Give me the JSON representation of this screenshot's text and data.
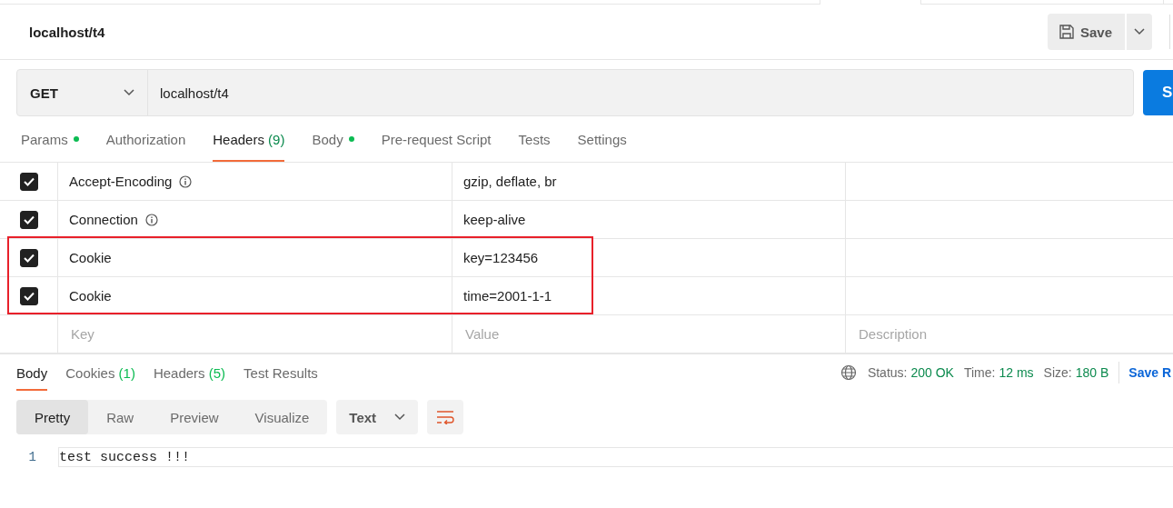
{
  "request": {
    "title": "localhost/t4",
    "save_label": "Save",
    "method": "GET",
    "url": "localhost/t4",
    "send_label": "S"
  },
  "tabs": [
    {
      "label": "Params",
      "dot": true,
      "selected": false
    },
    {
      "label": "Authorization",
      "dot": false,
      "selected": false
    },
    {
      "label": "Headers",
      "count": "(9)",
      "dot": false,
      "selected": true
    },
    {
      "label": "Body",
      "dot": true,
      "selected": false
    },
    {
      "label": "Pre-request Script",
      "dot": false,
      "selected": false
    },
    {
      "label": "Tests",
      "dot": false,
      "selected": false
    },
    {
      "label": "Settings",
      "dot": false,
      "selected": false
    }
  ],
  "headers": [
    {
      "checked": true,
      "key": "Accept-Encoding",
      "info": true,
      "value": "gzip, deflate, br",
      "highlighted": false
    },
    {
      "checked": true,
      "key": "Connection",
      "info": true,
      "value": "keep-alive",
      "highlighted": false
    },
    {
      "checked": true,
      "key": "Cookie",
      "info": false,
      "value": "key=123456",
      "highlighted": true
    },
    {
      "checked": true,
      "key": "Cookie",
      "info": false,
      "value": "time=2001-1-1",
      "highlighted": true
    }
  ],
  "new_row": {
    "key_placeholder": "Key",
    "value_placeholder": "Value",
    "description_placeholder": "Description"
  },
  "response": {
    "tabs": [
      {
        "label": "Body",
        "selected": true
      },
      {
        "label": "Cookies",
        "count": "(1)",
        "selected": false
      },
      {
        "label": "Headers",
        "count": "(5)",
        "selected": false
      },
      {
        "label": "Test Results",
        "selected": false
      }
    ],
    "status_label": "Status:",
    "status": "200 OK",
    "time_label": "Time:",
    "time": "12 ms",
    "size_label": "Size:",
    "size": "180 B",
    "save_label": "Save R",
    "views": [
      {
        "label": "Pretty",
        "selected": true
      },
      {
        "label": "Raw",
        "selected": false
      },
      {
        "label": "Preview",
        "selected": false
      },
      {
        "label": "Visualize",
        "selected": false
      }
    ],
    "format": "Text",
    "lines": [
      {
        "number": "1",
        "text": "test success !!!"
      }
    ]
  }
}
